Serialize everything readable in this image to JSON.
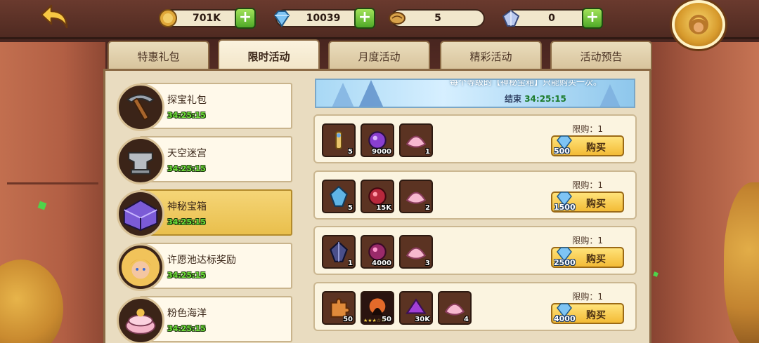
{
  "colors": {
    "accent_green": "#6fe13a",
    "buy_button": "#f3bb36",
    "selected_item": "#e9bf4c",
    "panel_bg": "#e9dcc0"
  },
  "header": {
    "back_icon": "back-arrow-icon",
    "resources": [
      {
        "icon": "gold-coin-icon",
        "amount": "701K"
      },
      {
        "icon": "diamond-icon",
        "amount": "10039"
      },
      {
        "icon": "scroll-icon",
        "amount": "5"
      },
      {
        "icon": "crystal-card-icon",
        "amount": "0"
      }
    ],
    "avatar_icon": "hero-avatar-icon"
  },
  "tabs": [
    {
      "label": "特惠礼包"
    },
    {
      "label": "限时活动",
      "active": true
    },
    {
      "label": "月度活动"
    },
    {
      "label": "精彩活动"
    },
    {
      "label": "活动预告"
    }
  ],
  "sidebar": {
    "items": [
      {
        "name": "探宝礼包",
        "timer": "34:25:15",
        "icon": "pickaxe-icon"
      },
      {
        "name": "天空迷宫",
        "timer": "34:25:15",
        "icon": "anvil-icon"
      },
      {
        "name": "神秘宝箱",
        "timer": "34:25:15",
        "icon": "crystal-chest-icon",
        "selected": true
      },
      {
        "name": "许愿池达标奖励",
        "timer": "34:25:15",
        "icon": "hero-portrait-icon"
      },
      {
        "name": "粉色海洋",
        "timer": "34:25:15",
        "icon": "pink-cake-icon"
      }
    ]
  },
  "banner": {
    "description": "每个等级的【神秘宝箱】只能购买一次。",
    "end_label": "结束",
    "end_time": "34:25:15"
  },
  "offers": [
    {
      "limit": "限购：1",
      "buy_label": "购买",
      "price": "500",
      "items": [
        {
          "icon": "scroll-item-icon",
          "qty": "5"
        },
        {
          "icon": "purple-orb-icon",
          "qty": "9000"
        },
        {
          "icon": "pink-shell-icon",
          "qty": "1"
        }
      ]
    },
    {
      "limit": "限购：1",
      "buy_label": "购买",
      "price": "1500",
      "items": [
        {
          "icon": "blue-crystal-icon",
          "qty": "5"
        },
        {
          "icon": "red-orb-icon",
          "qty": "15K"
        },
        {
          "icon": "pink-shell-icon",
          "qty": "2"
        }
      ]
    },
    {
      "limit": "限购：1",
      "buy_label": "购买",
      "price": "2500",
      "items": [
        {
          "icon": "dark-crystal-icon",
          "qty": "1"
        },
        {
          "icon": "red-orb-icon",
          "qty": "4000"
        },
        {
          "icon": "pink-shell-icon",
          "qty": "3"
        }
      ]
    },
    {
      "limit": "限购：1",
      "buy_label": "购买",
      "price": "4000",
      "items": [
        {
          "icon": "puzzle-piece-icon",
          "qty": "50"
        },
        {
          "icon": "hero-shard-icon",
          "qty": "50",
          "stars": "★★★☆☆"
        },
        {
          "icon": "purple-gem-icon",
          "qty": "30K"
        },
        {
          "icon": "pink-shell-icon",
          "qty": "4"
        }
      ]
    }
  ]
}
